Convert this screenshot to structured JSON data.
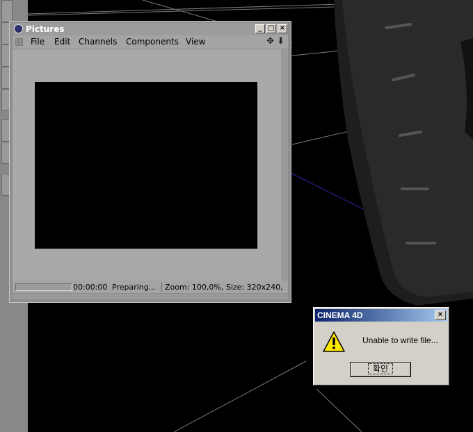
{
  "pictures_window": {
    "title": "Pictures",
    "menu": [
      "File",
      "Edit",
      "Channels",
      "Components",
      "View"
    ],
    "status": {
      "progress": 0,
      "time": "00:00:00",
      "state": "Preparing...",
      "zoom_size": "Zoom: 100,0%, Size: 320x240,"
    }
  },
  "dialog": {
    "title": "CINEMA 4D",
    "message": "Unable to write file...",
    "ok_label": "확인",
    "icon": "warning-icon"
  },
  "colors": {
    "dialog_title_start": "#0a246a",
    "dialog_title_end": "#a6caf0",
    "viewport_background": "#000000"
  }
}
